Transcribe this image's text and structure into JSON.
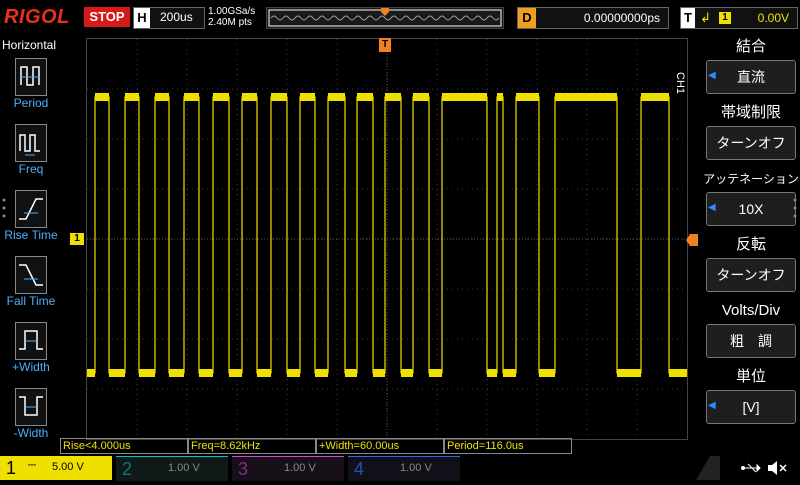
{
  "topbar": {
    "brand": "RIGOL",
    "run_state": "STOP",
    "timebase_key": "H",
    "timebase": "200us",
    "sample_rate": "1.00GSa/s",
    "memory_depth": "2.40M pts",
    "delay_key": "D",
    "delay": "0.00000000ps",
    "trigger_key": "T",
    "trigger_edge": "↲",
    "trigger_source": "1",
    "trigger_level": "0.00V"
  },
  "left_menu": {
    "title": "Horizontal",
    "items": [
      {
        "label": "Period",
        "icon": "period-icon"
      },
      {
        "label": "Freq",
        "icon": "freq-icon"
      },
      {
        "label": "Rise Time",
        "icon": "rise-time-icon"
      },
      {
        "label": "Fall Time",
        "icon": "fall-time-icon"
      },
      {
        "label": "+Width",
        "icon": "positive-width-icon"
      },
      {
        "label": "-Width",
        "icon": "negative-width-icon"
      }
    ]
  },
  "right_menu": {
    "channel_label": "CH1",
    "items": [
      {
        "title": "結合",
        "value": "直流",
        "has_arrow": true
      },
      {
        "title": "帯域制限",
        "value": "ターンオフ",
        "has_arrow": false
      },
      {
        "title": "アッテネーション",
        "value": "10X",
        "has_arrow": true
      },
      {
        "title": "反転",
        "value": "ターンオフ",
        "has_arrow": false
      },
      {
        "title": "Volts/Div",
        "value": "粗　調",
        "has_arrow": false
      },
      {
        "title": "単位",
        "value": "[V]",
        "has_arrow": true
      }
    ]
  },
  "measurements": {
    "rise": "Rise<4.000us",
    "freq": "Freq=8.62kHz",
    "pwidth": "+Width=60.00us",
    "period": "Period=116.0us"
  },
  "channels": [
    {
      "num": "1",
      "scale": "5.00 V",
      "active": true
    },
    {
      "num": "2",
      "scale": "1.00 V",
      "active": false
    },
    {
      "num": "3",
      "scale": "1.00 V",
      "active": false
    },
    {
      "num": "4",
      "scale": "1.00 V",
      "active": false
    }
  ],
  "markers": {
    "ch1_ground": "1",
    "trigger_pos": "T"
  },
  "colors": {
    "ch1": "#f0e000",
    "ch2": "#00c8c8",
    "ch3": "#e040e0",
    "ch4": "#2a6cff",
    "accent_blue": "#4ab0ff",
    "stop": "#d61a1a",
    "trigger_marker": "#f08020"
  }
}
